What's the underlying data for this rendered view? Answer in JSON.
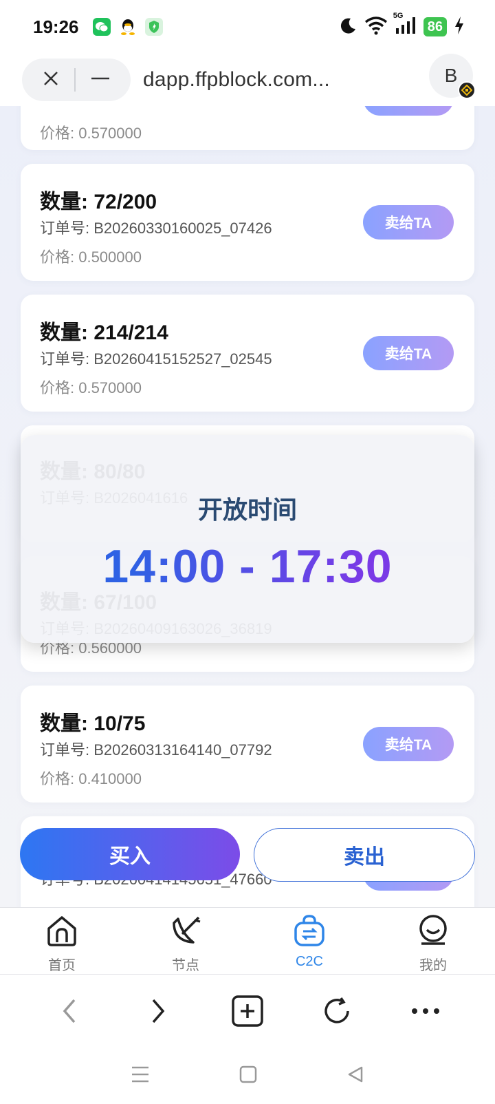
{
  "status_bar": {
    "time": "19:26",
    "network": "5G",
    "battery": "86",
    "icons": [
      "wechat-icon",
      "qq-icon",
      "shield-icon",
      "moon-icon",
      "wifi-icon",
      "signal-icon",
      "battery-icon",
      "charging-icon"
    ]
  },
  "browser": {
    "url": "dapp.ffpblock.com...",
    "profile_letter": "B"
  },
  "orders": [
    {
      "price": "价格: 0.570000"
    },
    {
      "quantity": "数量: 72/200",
      "order_no": "订单号: B20260330160025_07426",
      "price": "价格: 0.500000",
      "button": "卖给TA"
    },
    {
      "quantity": "数量: 214/214",
      "order_no": "订单号: B20260415152527_02545",
      "price": "价格: 0.570000",
      "button": "卖给TA"
    },
    {
      "quantity": "数量: 80/80",
      "order_no": "订单号: B2026041616"
    },
    {
      "quantity": "数量: 67/100",
      "order_no": "订单号: B20260409163026_36819",
      "price": "价格: 0.560000"
    },
    {
      "quantity": "数量: 10/75",
      "order_no": "订单号: B20260313164140_07792",
      "price": "价格: 0.410000",
      "button": "卖给TA"
    },
    {
      "order_no": "订单号: B20260414145651_47660",
      "button": "卖给TA"
    }
  ],
  "overlay": {
    "title": "开放时间",
    "time_range": "14:00 - 17:30"
  },
  "actions": {
    "buy": "买入",
    "sell": "卖出"
  },
  "tabs": [
    {
      "label": "首页",
      "icon": "home-icon"
    },
    {
      "label": "节点",
      "icon": "node-icon"
    },
    {
      "label": "C2C",
      "icon": "c2c-bag-icon",
      "active": true
    },
    {
      "label": "我的",
      "icon": "profile-icon"
    }
  ],
  "colors": {
    "accent_blue": "#2d77f2",
    "accent_purple": "#7c4ce8",
    "active_tab": "#2f86e8",
    "sell_ta_gradient": [
      "#8aa2ff",
      "#b39af4"
    ]
  }
}
